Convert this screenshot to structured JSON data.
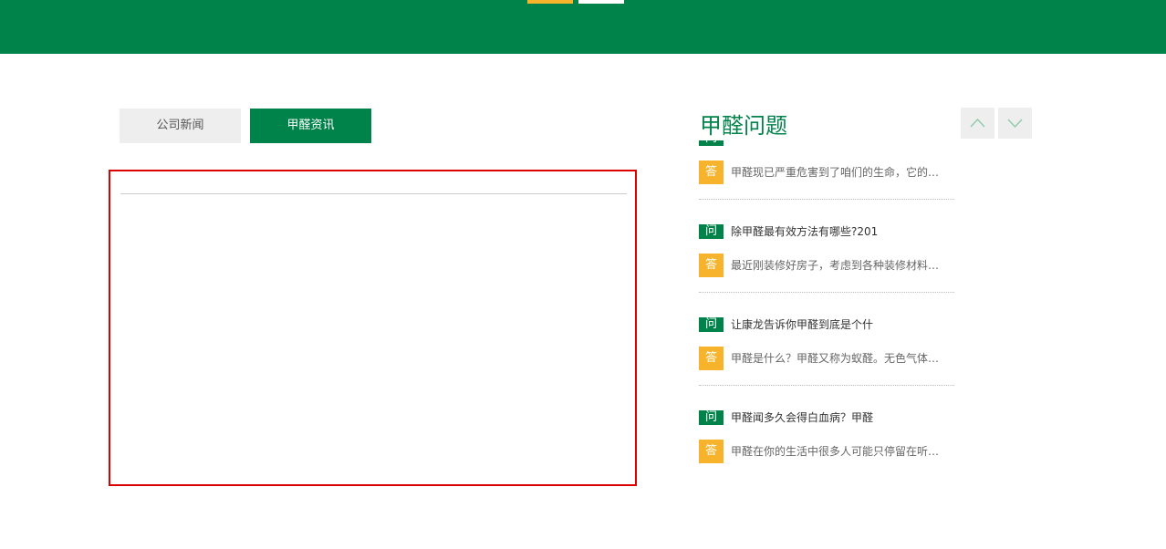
{
  "tabs": [
    {
      "label": "公司新闻",
      "active": false
    },
    {
      "label": "甲醛资讯",
      "active": true
    }
  ],
  "qa": {
    "title": "甲醛问题",
    "q_badge": "问",
    "a_badge": "答",
    "items": [
      {
        "question": "",
        "answer": "甲醛现已严重危害到了咱们的生命，它的…"
      },
      {
        "question": "除甲醛最有效方法有哪些?201",
        "answer": "最近刚装修好房子，考虑到各种装修材料…"
      },
      {
        "question": "让康龙告诉你甲醛到底是个什",
        "answer": "甲醛是什么？甲醛又称为蚁醛。无色气体…"
      },
      {
        "question": "甲醛闻多久会得白血病？甲醛",
        "answer": "甲醛在你的生活中很多人可能只停留在听…"
      }
    ]
  },
  "icons": {
    "up": "chevron-up-icon",
    "down": "chevron-down-icon"
  },
  "colors": {
    "brand_green": "#00834a",
    "accent_yellow": "#f7b32b",
    "highlight_red": "#dd0000",
    "tab_inactive_bg": "#eeeeee"
  }
}
